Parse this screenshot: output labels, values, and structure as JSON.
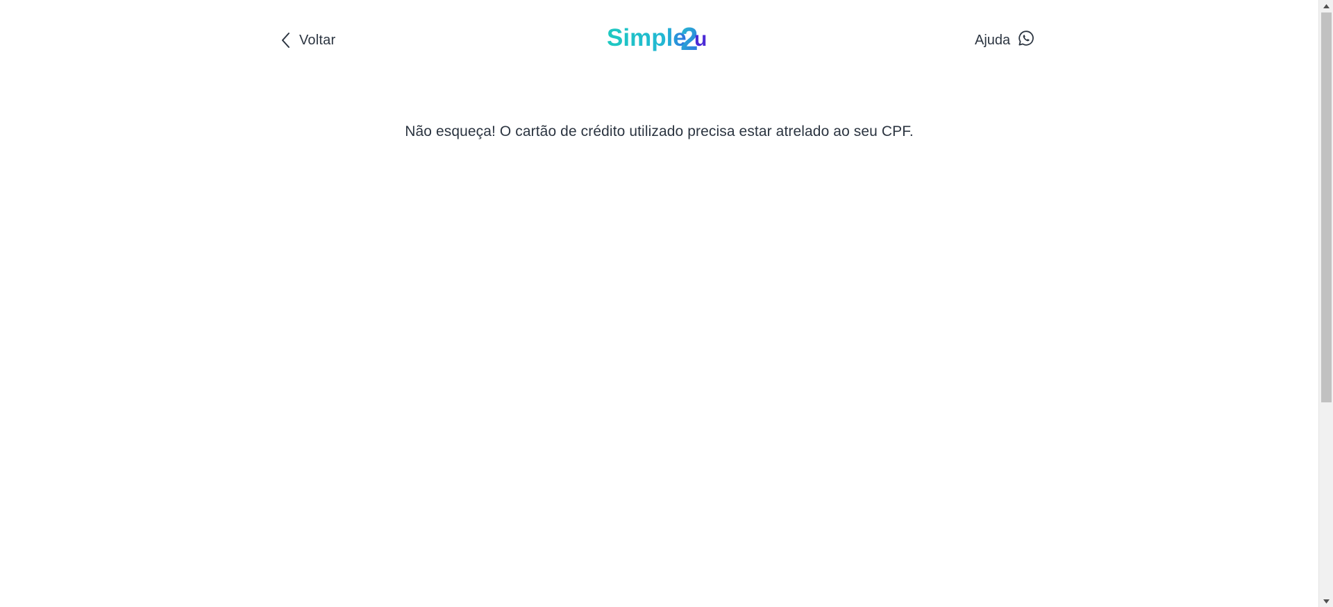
{
  "header": {
    "back_label": "Voltar",
    "help_label": "Ajuda",
    "logo_text_primary": "Simple",
    "logo_text_secondary": "2u",
    "icons": {
      "back": "chevron-left-icon",
      "help": "whatsapp-icon"
    }
  },
  "main": {
    "notice": "Não esqueça! O cartão de crédito utilizado precisa estar atrelado ao seu CPF."
  },
  "colors": {
    "text": "#2b3440",
    "brand_teal": "#1ec9c0",
    "brand_blue": "#2f6fe0",
    "brand_indigo": "#4b2bd6",
    "scrollbar_track": "#f1f1f1",
    "scrollbar_thumb": "#c1c1c1"
  }
}
